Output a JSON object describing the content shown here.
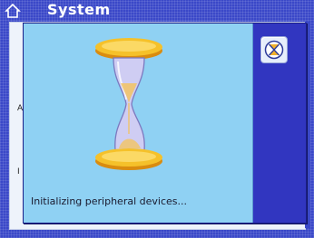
{
  "screen": {
    "title": "System",
    "home_icon": "home-icon",
    "rows": [
      {
        "label": "A"
      },
      {
        "label": "I"
      }
    ]
  },
  "dialog": {
    "message": "Initializing peripheral devices...",
    "hourglass_icon": "hourglass-icon",
    "cancel_icon": "cancel-hourglass-icon"
  },
  "colors": {
    "frame_blue": "#3a48c8",
    "dialog_body": "#8fd1f3",
    "hourglass_gold": "#f0b820",
    "hourglass_glass": "#c9c8f0",
    "sand": "#f1c46a"
  }
}
